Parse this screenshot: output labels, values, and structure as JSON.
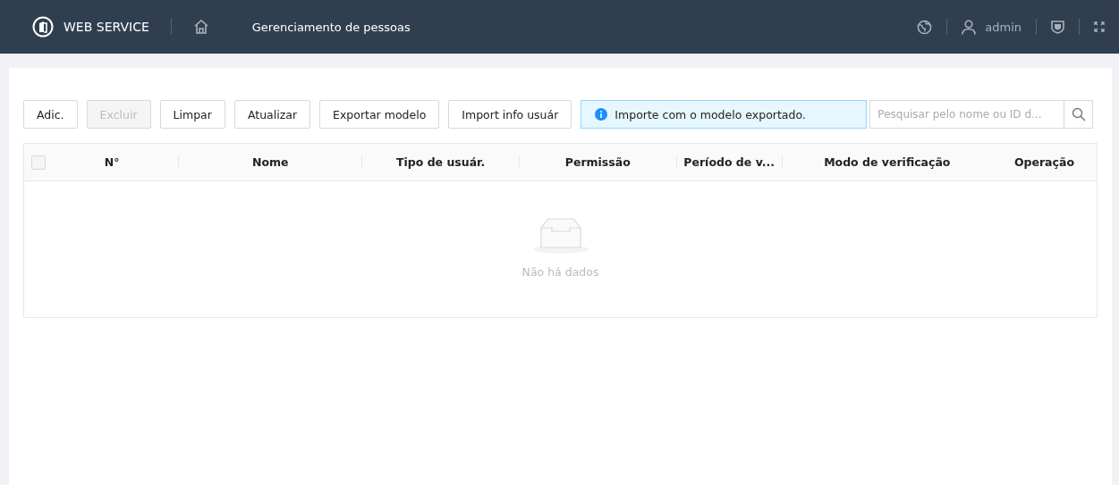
{
  "header": {
    "brand": "WEB SERVICE",
    "page_title": "Gerenciamento de pessoas",
    "user": "admin"
  },
  "toolbar": {
    "buttons": [
      {
        "label": "Adic.",
        "disabled": false
      },
      {
        "label": "Excluir",
        "disabled": true
      },
      {
        "label": "Limpar",
        "disabled": false
      },
      {
        "label": "Atualizar",
        "disabled": false
      },
      {
        "label": "Exportar modelo",
        "disabled": false
      },
      {
        "label": "Import info usuár",
        "disabled": false
      }
    ],
    "info": "Importe com o modelo exportado.",
    "search": {
      "placeholder": "Pesquisar pelo nome ou ID d..."
    }
  },
  "table": {
    "select_all": {
      "checked": false
    },
    "columns": [
      "N°",
      "Nome",
      "Tipo de usuár.",
      "Permissão",
      "Período de v...",
      "Modo de verificação",
      "Operação"
    ],
    "empty_text": "Não há dados"
  }
}
